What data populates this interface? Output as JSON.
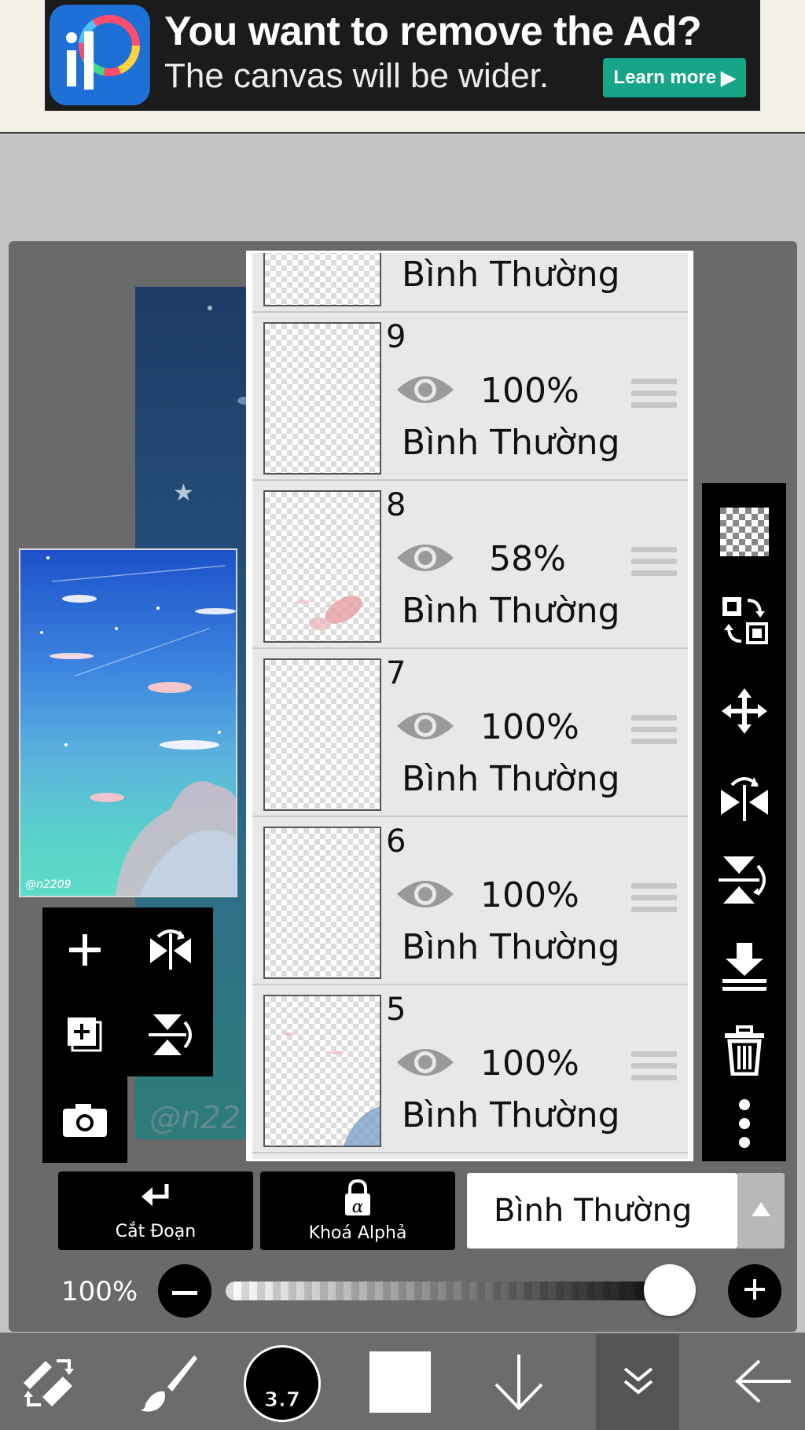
{
  "ad": {
    "title": "You want to remove the Ad?",
    "subtitle": "The canvas will be wider.",
    "button": "Learn more",
    "logo_letters": "iP"
  },
  "canvas": {
    "signature": "@n22"
  },
  "preview": {
    "signature": "@n2209"
  },
  "mini_tools": [
    "add-layer",
    "flip-horizontal",
    "add-layer-copy",
    "flip-vertical",
    "camera"
  ],
  "layers": [
    {
      "number": "",
      "opacity": "",
      "mode": "Bình Thường"
    },
    {
      "number": "9",
      "opacity": "100%",
      "mode": "Bình Thường"
    },
    {
      "number": "8",
      "opacity": "58%",
      "mode": "Bình Thường"
    },
    {
      "number": "7",
      "opacity": "100%",
      "mode": "Bình Thường"
    },
    {
      "number": "6",
      "opacity": "100%",
      "mode": "Bình Thường"
    },
    {
      "number": "5",
      "opacity": "100%",
      "mode": "Bình Thường"
    }
  ],
  "right_tools": [
    "transparent-bg",
    "swap-layers",
    "move",
    "flip-horizontal",
    "flip-vertical",
    "merge-down",
    "delete",
    "more"
  ],
  "bottom_controls": {
    "clip_label": "Cắt Đoạn",
    "alpha_label": "Khoá Alphả",
    "blend_mode": "Bình Thường",
    "opacity_label": "100%",
    "opacity_value": 1.0
  },
  "bottom_bar": {
    "brush_size": "3.7",
    "color": "#ffffff"
  }
}
